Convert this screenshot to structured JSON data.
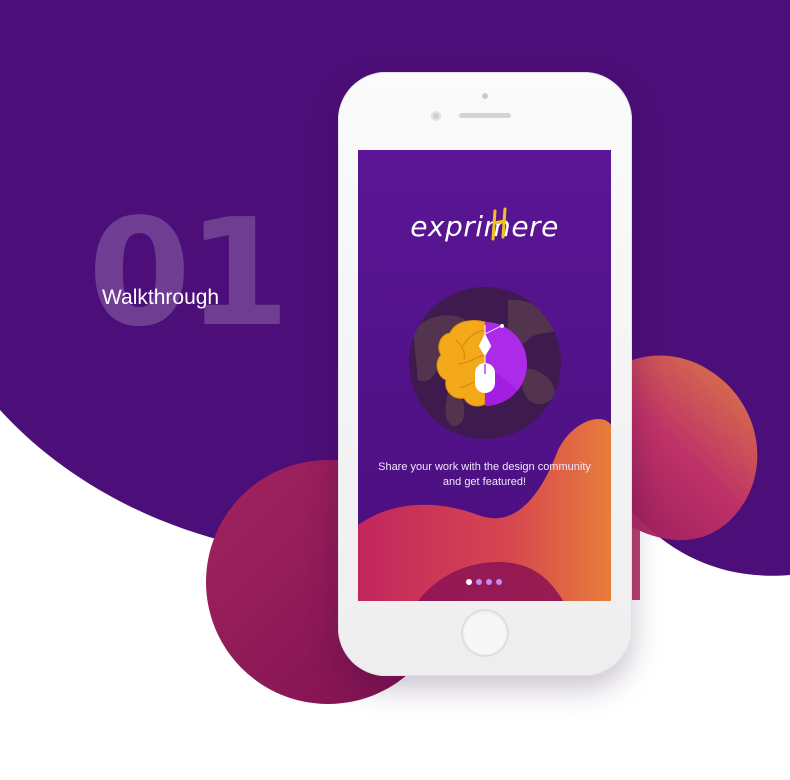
{
  "hero": {
    "number": "01",
    "title": "Walkthrough"
  },
  "app": {
    "logo_text": "exprimere",
    "caption_line1": "Share your work with the design community",
    "caption_line2": "and get featured!"
  },
  "pager": {
    "total": 4,
    "active_index": 0
  },
  "colors": {
    "background_purple": "#4c0e78",
    "screen_purple": "#5a1596",
    "accent_yellow": "#f2c11a",
    "brain_orange": "#f4a91a",
    "half_purple": "#a11ee2",
    "blob_pink": "#c2276a",
    "blob_orange": "#e8753a"
  },
  "icons": {
    "brain": "brain-half-icon",
    "mouse": "mouse-icon",
    "pen": "pen-tool-icon",
    "globe": "globe-icon"
  }
}
